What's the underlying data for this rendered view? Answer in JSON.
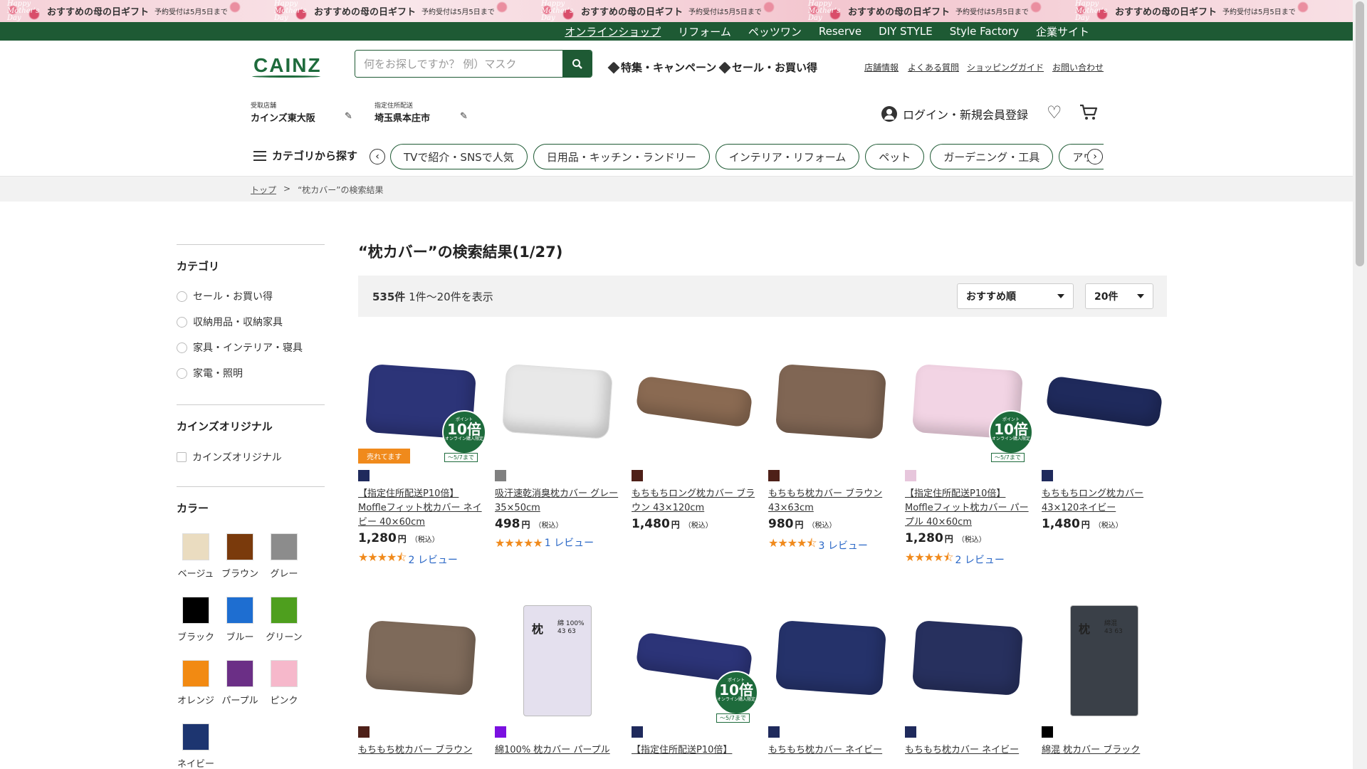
{
  "promo": {
    "logo_text": "Happy Mother's Day",
    "text": "おすすめの母の日ギフト",
    "sub": "予約受付は5月5日まで",
    "repeat": 5
  },
  "topnav": [
    "オンラインショップ",
    "リフォーム",
    "ペッツワン",
    "Reserve",
    "DIY STYLE",
    "Style Factory",
    "企業サイト"
  ],
  "header": {
    "logo": "CAINZ",
    "search_placeholder": "何をお探しですか？ 例）マスク",
    "feature_link": "特集・キャンペーン",
    "sale_link": "セール・お買い得",
    "util_links": [
      "店舗情報",
      "よくある質問",
      "ショッピングガイド",
      "お問い合わせ"
    ],
    "store_label": "受取店舗",
    "store_value": "カインズ東大阪",
    "address_label": "指定住所配送",
    "address_value": "埼玉県本庄市",
    "login": "ログイン・新規会員登録"
  },
  "category": {
    "menu_label": "カテゴリから探す",
    "chips": [
      "TVで紹介・SNSで人気",
      "日用品・キッチン・ランドリー",
      "インテリア・リフォーム",
      "ペット",
      "ガーデニング・工具",
      "アウトドア・カー用品"
    ]
  },
  "breadcrumb": {
    "top": "トップ",
    "sep": ">",
    "current": "“枕カバー”の検索結果"
  },
  "sidebar": {
    "category_head": "カテゴリ",
    "categories": [
      "セール・お買い得",
      "収納用品・収納家具",
      "家具・インテリア・寝具",
      "家電・照明"
    ],
    "original_head": "カインズオリジナル",
    "original_option": "カインズオリジナル",
    "color_head": "カラー",
    "colors": [
      {
        "label": "ベージュ",
        "hex": "#eadcc0"
      },
      {
        "label": "ブラウン",
        "hex": "#7a3a0c"
      },
      {
        "label": "グレー",
        "hex": "#8c8c8c"
      },
      {
        "label": "ブラック",
        "hex": "#000000"
      },
      {
        "label": "ブルー",
        "hex": "#1e6ed1"
      },
      {
        "label": "グリーン",
        "hex": "#4e9f1e"
      },
      {
        "label": "オレンジ",
        "hex": "#f28a12"
      },
      {
        "label": "パープル",
        "hex": "#6b2f86"
      },
      {
        "label": "ピンク",
        "hex": "#f6b8cb"
      },
      {
        "label": "ネイビー",
        "hex": "#1d3570"
      }
    ]
  },
  "results": {
    "title": "“枕カバー”の検索結果(1/27)",
    "count": "535件",
    "range": "1件〜20件を表示",
    "sort": "おすすめ順",
    "per_page": "20件"
  },
  "point_badge": {
    "top": "ポイント",
    "num": "10倍",
    "sub": "オンライン購入限定",
    "date": "〜5/7まで"
  },
  "sale_badge": "売れてます",
  "products": [
    {
      "swatch": "#1f2a5c",
      "name": "【指定住所配送P10倍】Moffleフィット枕カバー ネイビー 40×60cm",
      "price": "1,280",
      "stars": "★★★★⯪",
      "reviews": "2 レビュー"
    },
    {
      "swatch": "#808080",
      "name": "吸汗速乾消臭枕カバー グレー 35×50cm",
      "price": "498",
      "stars": "★★★★★",
      "reviews": "1 レビュー"
    },
    {
      "swatch": "#4e2018",
      "name": "もちもちロング枕カバー ブラウン 43×120cm",
      "price": "1,480",
      "stars": "",
      "reviews": ""
    },
    {
      "swatch": "#4e2018",
      "name": "もちもち枕カバー ブラウン 43×63cm",
      "price": "980",
      "stars": "★★★★⯪",
      "reviews": "3 レビュー"
    },
    {
      "swatch": "#e7c6dc",
      "name": "【指定住所配送P10倍】Moffleフィット枕カバー パープル 40×60cm",
      "price": "1,280",
      "stars": "★★★★⯪",
      "reviews": "2 レビュー"
    },
    {
      "swatch": "#1f2a5c",
      "name": "もちもちロング枕カバー 43×120ネイビー",
      "price": "1,480",
      "stars": "",
      "reviews": ""
    },
    {
      "swatch": "#4e2018",
      "name": "もちもち枕カバー ブラウン",
      "price": "",
      "stars": "",
      "reviews": ""
    },
    {
      "swatch": "#7a10e0",
      "name": "綿100% 枕カバー パープル",
      "price": "",
      "stars": "",
      "reviews": ""
    },
    {
      "swatch": "#1f2a5c",
      "name": "【指定住所配送P10倍】",
      "price": "",
      "stars": "",
      "reviews": ""
    },
    {
      "swatch": "#1f2a5c",
      "name": "もちもち枕カバー ネイビー",
      "price": "",
      "stars": "",
      "reviews": ""
    },
    {
      "swatch": "#1f2a5c",
      "name": "もちもち枕カバー ネイビー",
      "price": "",
      "stars": "",
      "reviews": ""
    },
    {
      "swatch": "#000000",
      "name": "綿混 枕カバー ブラック",
      "price": "",
      "stars": "",
      "reviews": ""
    }
  ],
  "package_labels": {
    "pillow": "枕",
    "cotton": "綿 100%",
    "size": "43 63",
    "blend": "綿混"
  },
  "price_yen": "円",
  "price_tax": "（税込）",
  "colors": {
    "brand_green": "#1e5a34",
    "accent_orange": "#f08a1c",
    "link_blue": "#2a67c6"
  }
}
